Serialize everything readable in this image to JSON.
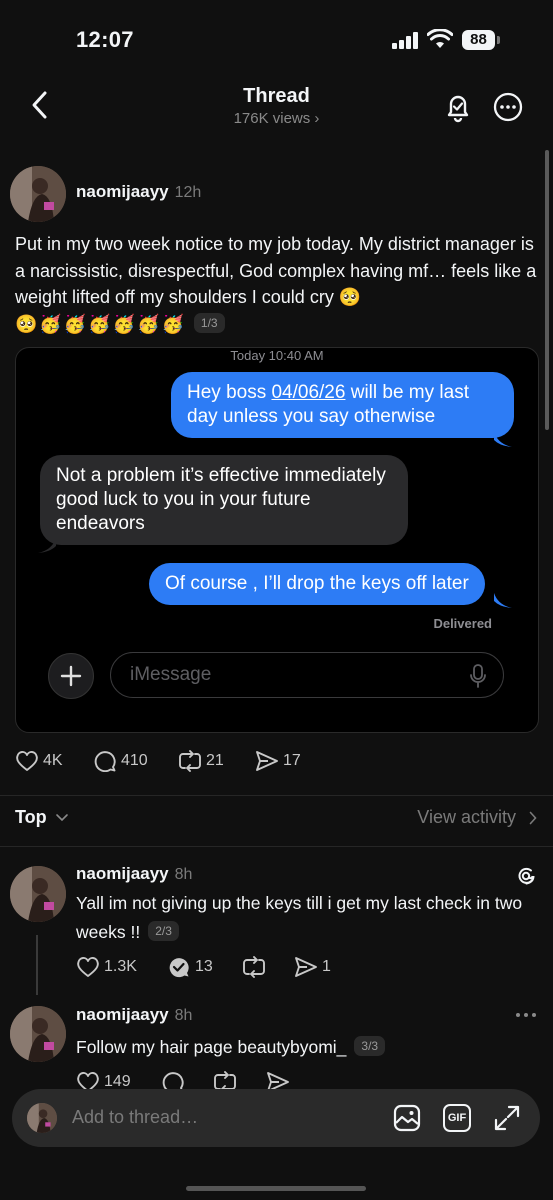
{
  "status_bar": {
    "time": "12:07",
    "battery": "88"
  },
  "header": {
    "title": "Thread",
    "views": "176K views ›"
  },
  "post": {
    "username": "naomijaayy",
    "time": "12h",
    "text": "Put in my two week notice to my job today. My district manager is a narcissistic, disrespectful, God complex having mf… feels like a weight lifted off my shoulders I could cry 🥺",
    "emojis": "🥺🥳🥳🥳🥳🥳🥳",
    "page": "1/3",
    "likes": "4K",
    "replies": "410",
    "reposts": "21",
    "shares": "17"
  },
  "imessage": {
    "date_label": "Today 10:40 AM",
    "msg1_prefix": "Hey boss ",
    "msg1_link": "04/06/26",
    "msg1_suffix": " will be my last day unless you say otherwise",
    "msg2": "Not a problem it’s effective immediately good luck to you in your future endeavors",
    "msg3": "Of course , I’ll drop the keys off later",
    "delivered": "Delivered",
    "input_placeholder": "iMessage"
  },
  "sort": {
    "label": "Top",
    "view_activity": "View activity"
  },
  "replies": [
    {
      "username": "naomijaayy",
      "time": "8h",
      "text": "Yall im not giving up the keys till i get my last check in two weeks !!",
      "page": "2/3",
      "likes": "1.3K",
      "replies": "13",
      "reposts": "",
      "shares": "1"
    },
    {
      "username": "naomijaayy",
      "time": "8h",
      "text": "Follow my hair page beautybyomi_",
      "page": "3/3",
      "likes": "149"
    }
  ],
  "composer": {
    "placeholder": "Add to thread…",
    "gif_label": "GIF"
  }
}
